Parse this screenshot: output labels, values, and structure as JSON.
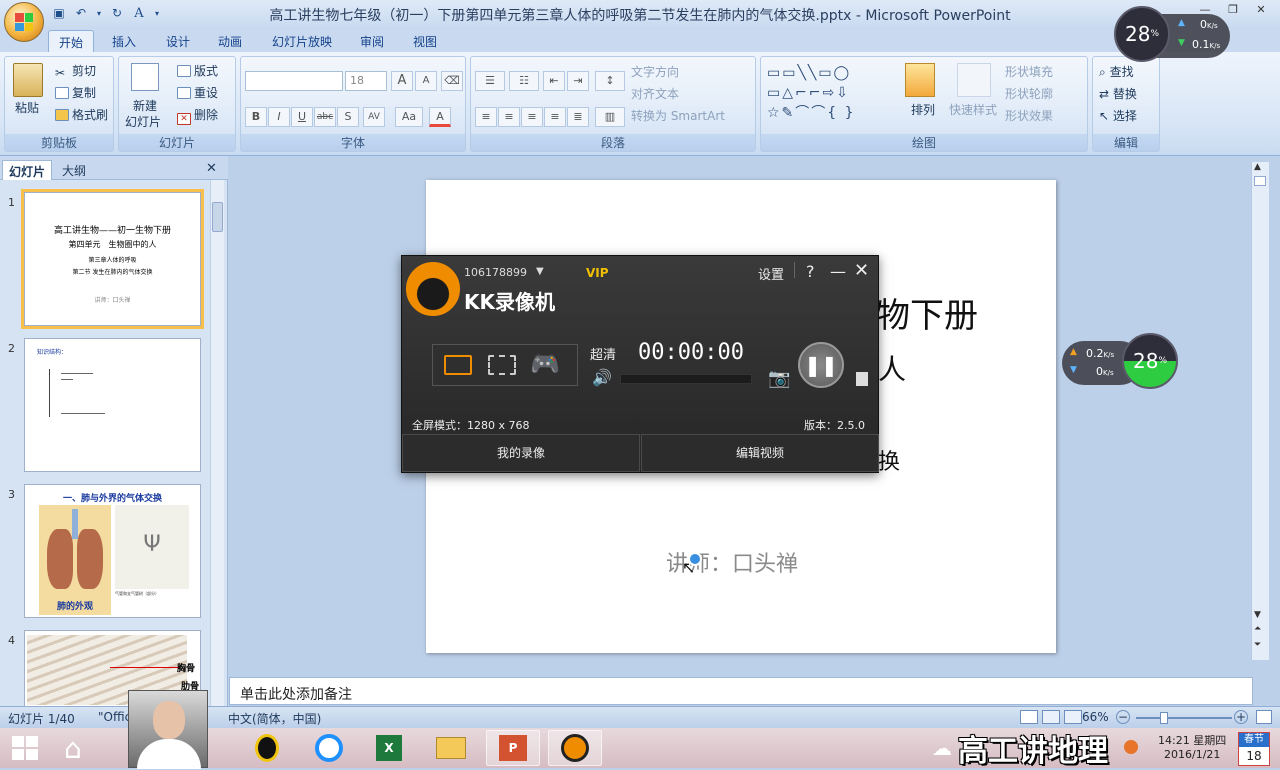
{
  "window": {
    "title": "高工讲生物七年级（初一）下册第四单元第三章人体的呼吸第二节发生在肺内的气体交换.pptx - Microsoft PowerPoint"
  },
  "tabs": [
    "开始",
    "插入",
    "设计",
    "动画",
    "幻灯片放映",
    "审阅",
    "视图"
  ],
  "ribbon": {
    "clipboard": {
      "paste": "粘贴",
      "cut": "剪切",
      "copy": "复制",
      "format_painter": "格式刷",
      "label": "剪贴板"
    },
    "slides": {
      "new_slide_1": "新建",
      "new_slide_2": "幻灯片",
      "layout": "版式",
      "reset": "重设",
      "delete": "删除",
      "label": "幻灯片"
    },
    "font": {
      "size": "18",
      "label": "字体",
      "grow": "A",
      "shrink": "A",
      "bold": "B",
      "italic": "I",
      "underline": "U",
      "strike": "abc",
      "shadow": "S",
      "spacing": "AV",
      "case": "Aa",
      "color": "A"
    },
    "paragraph": {
      "text_direction": "文字方向",
      "align_text": "对齐文本",
      "smartart": "转换为 SmartArt",
      "label": "段落"
    },
    "drawing": {
      "arrange": "排列",
      "quick_styles": "快速样式",
      "shape_fill": "形状填充",
      "shape_outline": "形状轮廓",
      "shape_effects": "形状效果",
      "label": "绘图"
    },
    "editing": {
      "find": "查找",
      "replace": "替换",
      "select": "选择",
      "label": "编辑"
    }
  },
  "left_panel": {
    "tab_slides": "幻灯片",
    "tab_outline": "大纲",
    "slide_nums": [
      "1",
      "2",
      "3",
      "4"
    ],
    "thumb1": {
      "l1": "高工讲生物——初一生物下册",
      "l2": "第四单元　生物圈中的人",
      "l3": "第三章人体的呼吸",
      "l4": "第二节 发生在肺内的气体交换",
      "l5": "讲师：口头禅"
    },
    "thumb2": {
      "title": "知识结构："
    },
    "thumb3": {
      "title": "一、肺与外界的气体交换",
      "caption": "肺的外观",
      "label2": "气管和支气管树（部分）"
    },
    "thumb4": {
      "label1": "胸骨",
      "label2": "肋骨"
    }
  },
  "slide": {
    "line1_tail": "物下册",
    "line2_tail": "人",
    "line3_tail": "换",
    "lecturer": "讲师：口头禅"
  },
  "notes": {
    "placeholder": "单击此处添加备注"
  },
  "status": {
    "slide_of": "幻灯片 1/40",
    "theme": "\"Office",
    "language": "中文(简体，中国)",
    "zoom": "66%"
  },
  "kk": {
    "account": "106178899",
    "vip": "VIP",
    "name": "KK录像机",
    "settings": "设置",
    "help": "?",
    "quality": "超清",
    "timer": "00:00:00",
    "mode": "全屏模式：1280 x 768",
    "version": "版本：2.5.0",
    "my_recordings": "我的录像",
    "edit_video": "编辑视频"
  },
  "net_top": {
    "percent": "28",
    "unit": "%",
    "up": "0",
    "down": "0.1",
    "rate_unit": "K/s"
  },
  "net_mid": {
    "percent": "28",
    "unit": "%",
    "up": "0.2",
    "down": "0",
    "rate_unit": "K/s"
  },
  "taskbar": {
    "overlay_text": "高工讲地理",
    "time": "14:21 星期四",
    "date": "2016/1/21",
    "calendar_top": "春节",
    "calendar_num": "18"
  },
  "colors": {
    "accent": "#f8c04a",
    "ribbon_blue": "#1e395b",
    "kk_orange": "#f08c00",
    "gauge_green": "#2ecc40"
  }
}
